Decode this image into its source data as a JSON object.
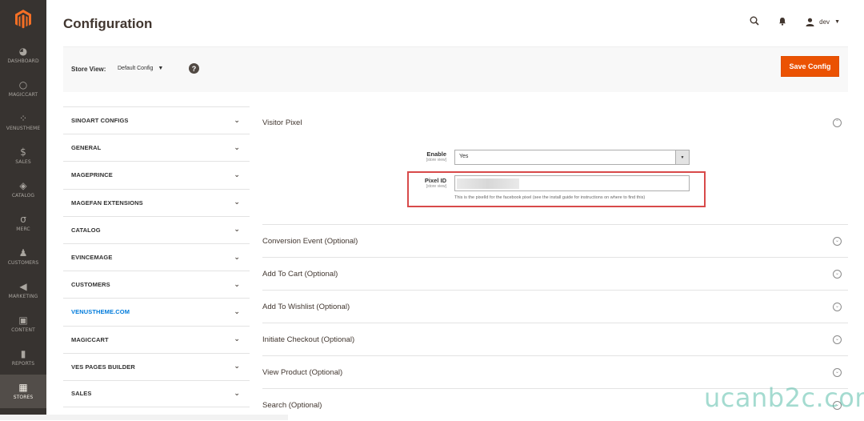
{
  "header": {
    "title": "Configuration",
    "user": "dev"
  },
  "nav": {
    "items": [
      {
        "label": "DASHBOARD",
        "icon": "dashboard-icon"
      },
      {
        "label": "MAGICCART",
        "icon": "magiccart-icon"
      },
      {
        "label": "VENUSTHEME",
        "icon": "venustheme-icon"
      },
      {
        "label": "SALES",
        "icon": "dollar-icon"
      },
      {
        "label": "CATALOG",
        "icon": "catalog-icon"
      },
      {
        "label": "MERC",
        "icon": "merc-icon"
      },
      {
        "label": "CUSTOMERS",
        "icon": "customers-icon"
      },
      {
        "label": "MARKETING",
        "icon": "megaphone-icon"
      },
      {
        "label": "CONTENT",
        "icon": "content-icon"
      },
      {
        "label": "REPORTS",
        "icon": "bar-chart-icon"
      },
      {
        "label": "STORES",
        "icon": "stores-icon"
      }
    ],
    "active": "STORES"
  },
  "store_view": {
    "label": "Store View:",
    "value": "Default Config"
  },
  "actions": {
    "save_label": "Save Config"
  },
  "tabs": [
    {
      "label": "SINOART CONFIGS"
    },
    {
      "label": "GENERAL"
    },
    {
      "label": "MAGEPRINCE"
    },
    {
      "label": "MAGEFAN EXTENSIONS"
    },
    {
      "label": "CATALOG"
    },
    {
      "label": "EVINCEMAGE"
    },
    {
      "label": "CUSTOMERS"
    },
    {
      "label": "VENUSTHEME.COM",
      "highlight": true
    },
    {
      "label": "MAGICCART"
    },
    {
      "label": "VES PAGES BUILDER"
    },
    {
      "label": "SALES"
    }
  ],
  "visitor_pixel": {
    "title": "Visitor Pixel",
    "enable": {
      "label": "Enable",
      "scope": "[store view]",
      "value": "Yes"
    },
    "pixel_id": {
      "label": "Pixel ID",
      "scope": "[store view]",
      "note": "This is the pixelId for the facebook pixel (see the install guide for instructions on where to find this)"
    }
  },
  "sections": [
    {
      "title": "Conversion Event (Optional)"
    },
    {
      "title": "Add To Cart (Optional)"
    },
    {
      "title": "Add To Wishlist (Optional)"
    },
    {
      "title": "Initiate Checkout (Optional)"
    },
    {
      "title": "View Product (Optional)"
    },
    {
      "title": "Search (Optional)"
    }
  ],
  "watermark": "ucanb2c.com",
  "colors": {
    "nav_bg": "#373330",
    "accent": "#eb5202",
    "highlight": "#d84a4a",
    "link": "#007bdb"
  }
}
